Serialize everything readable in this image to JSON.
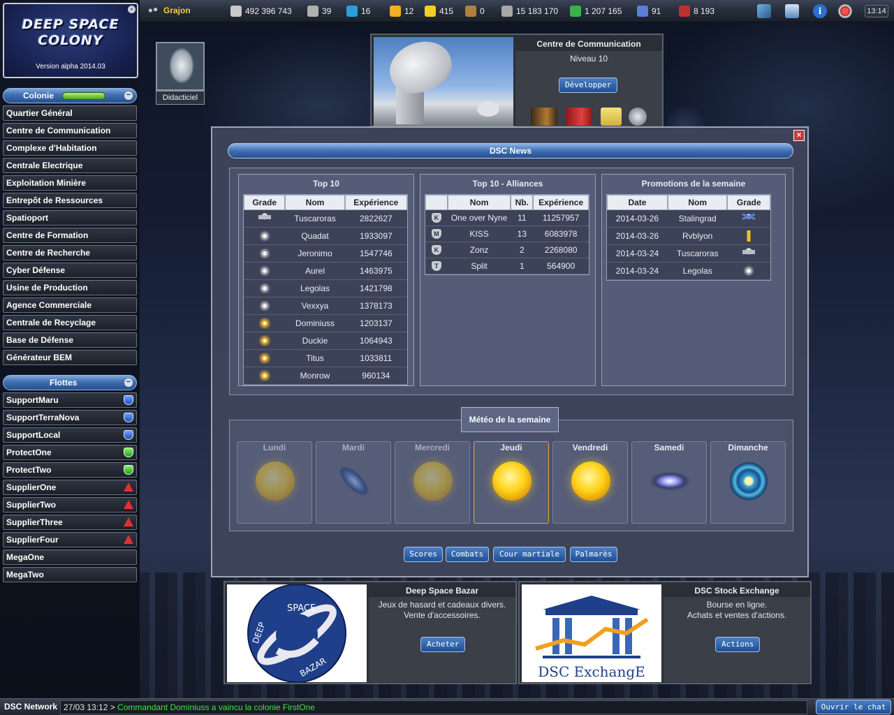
{
  "player": {
    "name": "Grajon"
  },
  "resources": [
    {
      "icon": "credits-icon",
      "value": "492 396 743",
      "color": "#c8c8c8"
    },
    {
      "icon": "population-icon",
      "value": "39",
      "color": "#b0b0b0"
    },
    {
      "icon": "droid-icon",
      "value": "16",
      "color": "#2a9fd8"
    },
    {
      "icon": "food-icon",
      "value": "12",
      "color": "#f0b020"
    },
    {
      "icon": "energy-icon",
      "value": "415",
      "color": "#f0d020"
    },
    {
      "icon": "mineral-icon",
      "value": "0",
      "color": "#b08040"
    },
    {
      "icon": "metal-icon",
      "value": "15 183 170",
      "color": "#a8a8a8"
    },
    {
      "icon": "crystal-icon",
      "value": "1 207 165",
      "color": "#3ab04a"
    },
    {
      "icon": "planet-icon",
      "value": "91",
      "color": "#5a7fd8"
    },
    {
      "icon": "fuel-icon",
      "value": "8 193",
      "color": "#c03030"
    }
  ],
  "clock": "13:14",
  "logo": {
    "line1": "DEEP SPACE",
    "line2": "COLONY",
    "version": "Version alpha 2014.03"
  },
  "colony": {
    "title": "Colonie",
    "items": [
      "Quartier Général",
      "Centre de Communication",
      "Complexe d'Habitation",
      "Centrale Electrique",
      "Exploitation Minière",
      "Entrepôt de Ressources",
      "Spatioport",
      "Centre de Formation",
      "Centre de Recherche",
      "Cyber Défense",
      "Usine de Production",
      "Agence Commerciale",
      "Centrale de Recyclage",
      "Base de Défense",
      "Générateur BEM"
    ]
  },
  "fleets": {
    "title": "Flottes",
    "items": [
      {
        "name": "SupportMaru",
        "icon": "shield-blue-icon"
      },
      {
        "name": "SupportTerraNova",
        "icon": "shield-blue-icon"
      },
      {
        "name": "SupportLocal",
        "icon": "shield-blue-icon"
      },
      {
        "name": "ProtectOne",
        "icon": "shield-green-icon"
      },
      {
        "name": "ProtectTwo",
        "icon": "shield-green-icon"
      },
      {
        "name": "SupplierOne",
        "icon": "warning-icon"
      },
      {
        "name": "SupplierTwo",
        "icon": "warning-icon"
      },
      {
        "name": "SupplierThree",
        "icon": "warning-icon"
      },
      {
        "name": "SupplierFour",
        "icon": "warning-icon"
      },
      {
        "name": "MegaOne",
        "icon": ""
      },
      {
        "name": "MegaTwo",
        "icon": ""
      }
    ]
  },
  "tutorial": {
    "label": "Didacticiel"
  },
  "building": {
    "title": "Centre de Communication",
    "level": "Niveau 10",
    "button": "Développer"
  },
  "news": {
    "title": "DSC News",
    "top10": {
      "title": "Top 10",
      "headers": [
        "Grade",
        "Nom",
        "Expérience"
      ],
      "rows": [
        {
          "grade": "eagle",
          "name": "Tuscaroras",
          "xp": "2822627"
        },
        {
          "grade": "star",
          "name": "Quadat",
          "xp": "1933097"
        },
        {
          "grade": "star",
          "name": "Jeronimo",
          "xp": "1547746"
        },
        {
          "grade": "star",
          "name": "Aurel",
          "xp": "1463975"
        },
        {
          "grade": "star",
          "name": "Legolas",
          "xp": "1421798"
        },
        {
          "grade": "star",
          "name": "Vexxya",
          "xp": "1378173"
        },
        {
          "grade": "gstar",
          "name": "Dominiuss",
          "xp": "1203137"
        },
        {
          "grade": "gstar",
          "name": "Duckie",
          "xp": "1064943"
        },
        {
          "grade": "gstar",
          "name": "Titus",
          "xp": "1033811"
        },
        {
          "grade": "gstar",
          "name": "Monrow",
          "xp": "960134"
        }
      ]
    },
    "alliances": {
      "title": "Top 10 - Alliances",
      "headers": [
        "",
        "Nom",
        "Nb.",
        "Expérience"
      ],
      "rows": [
        {
          "badge": "K",
          "name": "One over Nyne",
          "nb": "11",
          "xp": "11257957"
        },
        {
          "badge": "M",
          "name": "KISS",
          "nb": "13",
          "xp": "6083978"
        },
        {
          "badge": "K",
          "name": "Zonz",
          "nb": "2",
          "xp": "2268080"
        },
        {
          "badge": "T",
          "name": "Split",
          "nb": "1",
          "xp": "564900"
        }
      ]
    },
    "promotions": {
      "title": "Promotions de la semaine",
      "headers": [
        "Date",
        "Nom",
        "Grade"
      ],
      "rows": [
        {
          "date": "2014-03-26",
          "name": "Stalingrad",
          "grade": "chev"
        },
        {
          "date": "2014-03-26",
          "name": "Rvblyon",
          "grade": "gbar"
        },
        {
          "date": "2014-03-24",
          "name": "Tuscaroras",
          "grade": "eagle"
        },
        {
          "date": "2014-03-24",
          "name": "Legolas",
          "grade": "star"
        }
      ]
    },
    "weather": {
      "title": "Météo de la semaine",
      "days": [
        {
          "name": "Lundi",
          "kind": "sun",
          "past": true
        },
        {
          "name": "Mardi",
          "kind": "galaxy",
          "past": true
        },
        {
          "name": "Mercredi",
          "kind": "sun",
          "past": true
        },
        {
          "name": "Jeudi",
          "kind": "sun",
          "today": true
        },
        {
          "name": "Vendredi",
          "kind": "sun"
        },
        {
          "name": "Samedi",
          "kind": "storm"
        },
        {
          "name": "Dimanche",
          "kind": "vortex"
        }
      ]
    },
    "buttons": [
      "Scores",
      "Combats",
      "Cour martiale",
      "Palmarès"
    ]
  },
  "bazar": {
    "title": "Deep Space Bazar",
    "line1": "Jeux de hasard et cadeaux divers.",
    "line2": "Vente d'accessoires.",
    "button": "Acheter",
    "logo_top": "SPACE",
    "logo_left": "DEEP",
    "logo_bottom": "BAZAR"
  },
  "exchange": {
    "title": "DSC Stock Exchange",
    "line1": "Bourse en ligne.",
    "line2": "Achats et ventes d'actions.",
    "button": "Actions",
    "logo_text": "DSC ExchangE"
  },
  "status": {
    "network": "DSC Network",
    "time": "27/03 13:12 >",
    "message": "Commandant Dominiuss a vaincu la colonie FirstOne",
    "chat_button": "Ouvrir le chat"
  }
}
